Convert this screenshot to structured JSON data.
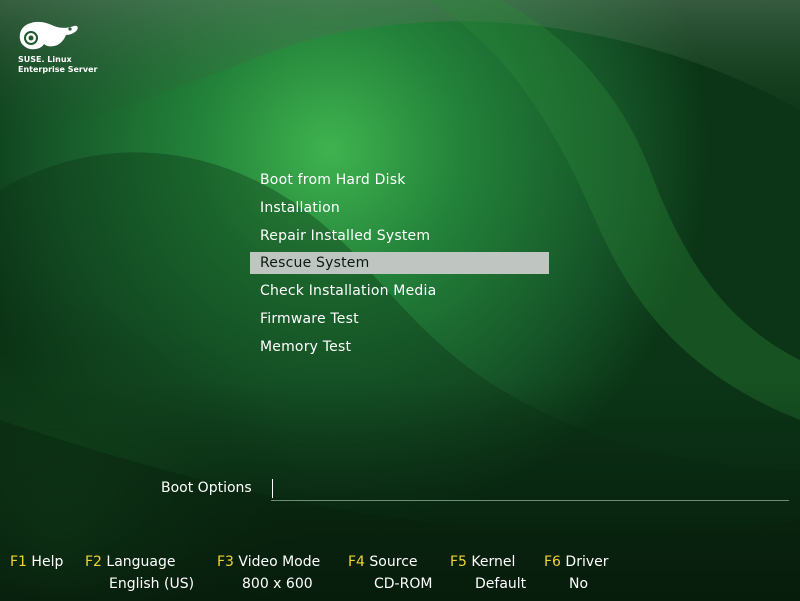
{
  "logo": {
    "line1": "SUSE. Linux",
    "line2": "Enterprise Server",
    "icon": "chameleon-icon"
  },
  "boot_menu": {
    "items": [
      {
        "label": "Boot from Hard Disk",
        "selected": false
      },
      {
        "label": "Installation",
        "selected": false
      },
      {
        "label": "Repair Installed System",
        "selected": false
      },
      {
        "label": "Rescue System",
        "selected": true
      },
      {
        "label": "Check Installation Media",
        "selected": false
      },
      {
        "label": "Firmware Test",
        "selected": false
      },
      {
        "label": "Memory Test",
        "selected": false
      }
    ]
  },
  "boot_options": {
    "label": "Boot Options",
    "value": ""
  },
  "function_keys": {
    "f1": {
      "key": "F1",
      "label": "Help"
    },
    "f2": {
      "key": "F2",
      "label": "Language",
      "value": "English (US)"
    },
    "f3": {
      "key": "F3",
      "label": "Video Mode",
      "value": "800 x 600"
    },
    "f4": {
      "key": "F4",
      "label": "Source",
      "value": "CD-ROM"
    },
    "f5": {
      "key": "F5",
      "label": "Kernel",
      "value": "Default"
    },
    "f6": {
      "key": "F6",
      "label": "Driver",
      "value": "No"
    }
  },
  "colors": {
    "background_dark": "#0a2a12",
    "background_mid": "#1f6a30",
    "highlight": "#3fb34f",
    "selection_bar": "#bfc6c1",
    "function_key": "#f2d330",
    "text": "#ffffff"
  }
}
